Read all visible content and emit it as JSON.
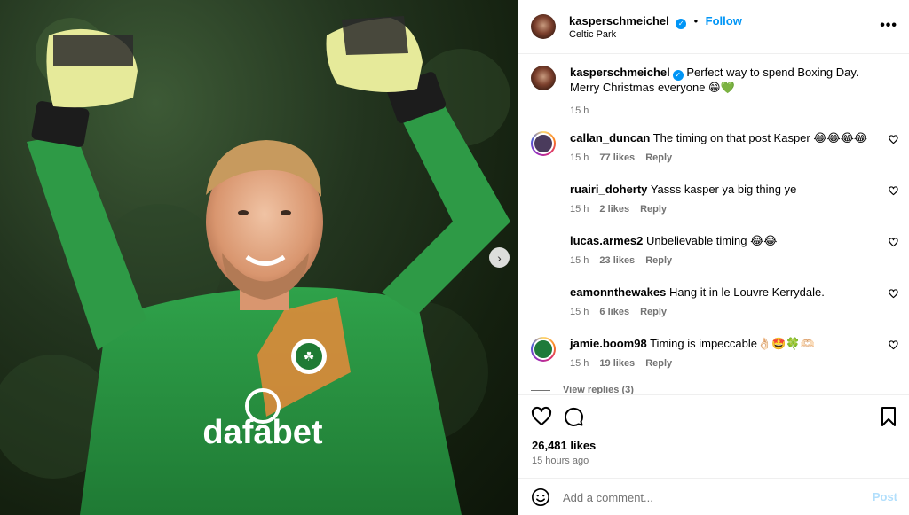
{
  "post": {
    "author": "kasperschmeichel",
    "follow_label": "Follow",
    "separator": "•",
    "location": "Celtic Park",
    "more_glyph": "•••"
  },
  "photo": {
    "next_glyph": "›",
    "logo_text": "dafabet"
  },
  "caption": {
    "author": "kasperschmeichel",
    "text": "Perfect way to spend Boxing Day. Merry Christmas everyone 😁💚",
    "time": "15 h"
  },
  "comments": [
    {
      "user": "callan_duncan",
      "text": "The timing on that post Kasper 😂😂😂😂",
      "time": "15 h",
      "likes": "77 likes",
      "reply": "Reply",
      "avatar_color": "#4a3b5c"
    },
    {
      "user": "ruairi_doherty",
      "text": "Yasss kasper ya big thing ye",
      "time": "15 h",
      "likes": "2 likes",
      "reply": "Reply",
      "avatar_color": "#8a6f7a"
    },
    {
      "user": "lucas.armes2",
      "text": "Unbelievable timing 😂😂",
      "time": "15 h",
      "likes": "23 likes",
      "reply": "Reply",
      "avatar_color": "#9c9aa8"
    },
    {
      "user": "eamonnthewakes",
      "text": "Hang it in le Louvre Kerrydale.",
      "time": "15 h",
      "likes": "6 likes",
      "reply": "Reply",
      "avatar_color": "#2f3a2d"
    },
    {
      "user": "jamie.boom98",
      "text": "Timing is impeccable👌🏻🤩🍀🫶🏻",
      "time": "15 h",
      "likes": "19 likes",
      "reply": "Reply",
      "avatar_color": "#1f7a3a"
    }
  ],
  "view_replies": "View replies (3)",
  "likes_total": "26,481 likes",
  "posted_ago": "15 hours ago",
  "composer": {
    "placeholder": "Add a comment...",
    "post_label": "Post"
  },
  "colors": {
    "accent": "#0095f6",
    "post_disabled": "#b2dffc",
    "muted": "#737373"
  }
}
